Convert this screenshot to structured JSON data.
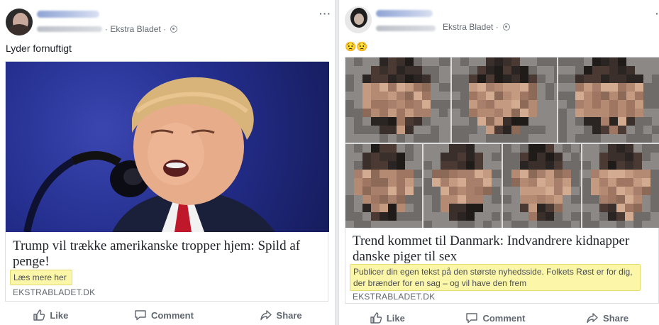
{
  "posts": [
    {
      "source": "Ekstra Bladet",
      "separator": "·",
      "more": "···",
      "text": "Lyder fornuftigt",
      "link": {
        "headline": "Trump vil trække amerikanske tropper hjem: Spild af penge!",
        "description": "Læs mere her",
        "domain": "EKSTRABLADET.DK"
      },
      "actions": {
        "like": "Like",
        "comment": "Comment",
        "share": "Share"
      }
    },
    {
      "source": "Ekstra Bladet",
      "separator": "·",
      "more": "·",
      "text": "😟😟",
      "link": {
        "headline": "Trend kommet til Danmark: Indvandrere kidnapper danske piger til sex",
        "description": "Publicer din egen tekst på den største nyhedsside. Folkets Røst er for dig, der brænder for en sag – og vil have den frem",
        "domain": "EKSTRABLADET.DK"
      },
      "actions": {
        "like": "Like",
        "comment": "Comment",
        "share": "Share"
      }
    }
  ],
  "colors": {
    "highlight": "#fbf6a8",
    "text": "#1d2129",
    "meta": "#616770",
    "divider": "#e9ebee"
  },
  "icons": [
    "globe-icon",
    "more-options-icon",
    "like-icon",
    "comment-icon",
    "share-icon"
  ]
}
